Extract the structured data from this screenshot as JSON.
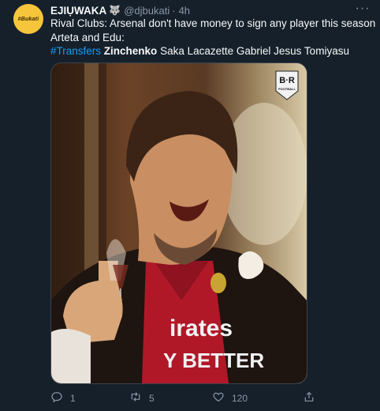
{
  "tweet": {
    "avatar_text": "#Bukati",
    "display_name": "EJIỤWAKA",
    "name_badge": "🐺",
    "handle": "@djbukati",
    "separator": "·",
    "time": "4h",
    "more": "···",
    "lines": {
      "line1": "Rival Clubs: Arsenal don't have money to sign any player this season",
      "line2": "Arteta and Edu:",
      "hashtag": "#Transfers",
      "bold_name": "Zinchenko",
      "rest": "Saka Lacazette Gabriel Jesus Tomiyasu"
    },
    "media": {
      "logo_text": "B·R",
      "logo_sub": "FOOTBALL",
      "shirt_line1": "irates",
      "shirt_line2": "Y BETTER"
    },
    "actions": {
      "replies": "1",
      "retweets": "5",
      "likes": "120"
    }
  }
}
